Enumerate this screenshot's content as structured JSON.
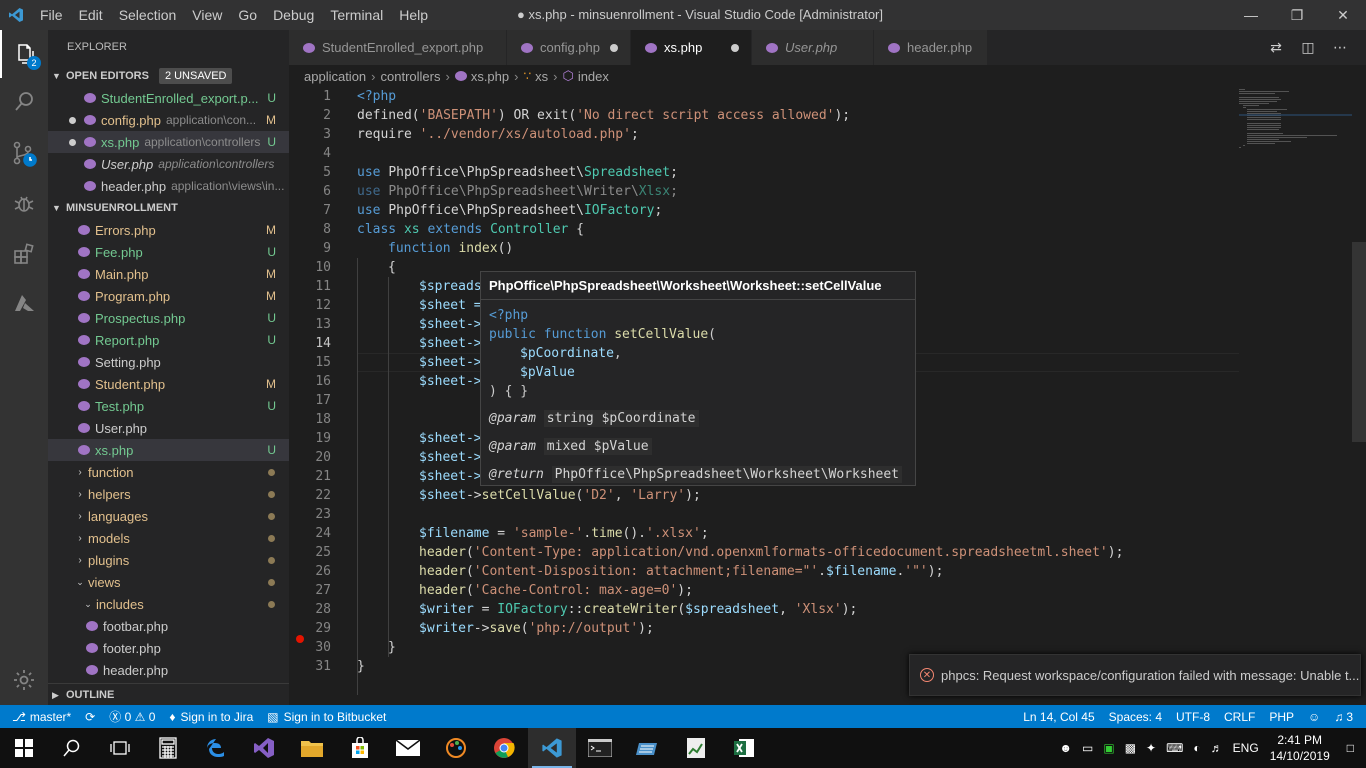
{
  "window": {
    "title": "● xs.php - minsuenrollment - Visual Studio Code [Administrator]",
    "menu": [
      "File",
      "Edit",
      "Selection",
      "View",
      "Go",
      "Debug",
      "Terminal",
      "Help"
    ]
  },
  "activity_bar": {
    "explorer_badge": "2"
  },
  "sidebar": {
    "header": "EXPLORER",
    "open_editors": {
      "title": "OPEN EDITORS",
      "unsaved": "2 UNSAVED",
      "items": [
        {
          "name": "StudentEnrolled_export.p...",
          "desc": "",
          "status": "U"
        },
        {
          "name": "config.php",
          "desc": "application\\con...",
          "status": "M"
        },
        {
          "name": "xs.php",
          "desc": "application\\controllers",
          "status": "U"
        },
        {
          "name": "User.php",
          "desc": "application\\controllers",
          "status": ""
        },
        {
          "name": "header.php",
          "desc": "application\\views\\in...",
          "status": ""
        }
      ]
    },
    "project": {
      "title": "MINSUENROLLMENT",
      "files": [
        {
          "name": "Errors.php",
          "status": "M"
        },
        {
          "name": "Fee.php",
          "status": "U"
        },
        {
          "name": "Main.php",
          "status": "M"
        },
        {
          "name": "Program.php",
          "status": "M"
        },
        {
          "name": "Prospectus.php",
          "status": "U"
        },
        {
          "name": "Report.php",
          "status": "U"
        },
        {
          "name": "Setting.php",
          "status": ""
        },
        {
          "name": "Student.php",
          "status": "M"
        },
        {
          "name": "Test.php",
          "status": "U"
        },
        {
          "name": "User.php",
          "status": ""
        },
        {
          "name": "xs.php",
          "status": "U"
        }
      ],
      "folders": [
        "function",
        "helpers",
        "languages",
        "models",
        "plugins",
        "views"
      ],
      "subfolder": "includes",
      "subfiles": [
        "footbar.php",
        "footer.php",
        "header.php"
      ]
    },
    "outline": "OUTLINE"
  },
  "tabs": [
    {
      "label": "StudentEnrolled_export.php"
    },
    {
      "label": "config.php"
    },
    {
      "label": "xs.php"
    },
    {
      "label": "User.php"
    },
    {
      "label": "header.php"
    }
  ],
  "breadcrumb": [
    "application",
    "controllers",
    "xs.php",
    "xs",
    "index"
  ],
  "code": {
    "line_numbers": [
      "1",
      "2",
      "3",
      "4",
      "5",
      "6",
      "7",
      "8",
      "9",
      "10",
      "11",
      "12",
      "13",
      "14",
      "15",
      "16",
      "17",
      "18",
      "19",
      "20",
      "21",
      "22",
      "23",
      "24",
      "25",
      "26",
      "27",
      "28",
      "29",
      "30",
      "31"
    ],
    "l1": "<?php",
    "l2a": "defined(",
    "l2b": "'BASEPATH'",
    "l2c": ") OR exit(",
    "l2d": "'No direct script access allowed'",
    "l2e": ");",
    "l3a": "require ",
    "l3b": "'../vendor/xs/autoload.php'",
    "l3c": ";",
    "l5a": "use ",
    "l5b": "PhpOffice\\PhpSpreadsheet\\",
    "l5c": "Spreadsheet",
    "l6a": "use ",
    "l6b": "PhpOffice\\PhpSpreadsheet\\Writer\\",
    "l6c": "Xlsx",
    "l7a": "use ",
    "l7b": "PhpOffice\\PhpSpreadsheet\\",
    "l7c": "IOFactory",
    "l8a": "class ",
    "l8b": "xs ",
    "l8c": "extends ",
    "l8d": "Controller",
    "l8e": " {",
    "l9a": "function ",
    "l9b": "index",
    "l9c": "()",
    "l10": "{",
    "l11": "$spreads",
    "l12": "$sheet =",
    "l13": "$sheet->",
    "l14": "$sheet->",
    "l15": "$sheet->",
    "l16": "$sheet->",
    "l19": "$sheet->",
    "l20": "$sheet->",
    "l21": "$sheet->",
    "l22a": "$sheet",
    "l22b": "->",
    "l22c": "setCellValue",
    "l22d": "(",
    "l22e": "'D2'",
    "l22f": ", ",
    "l22g": "'Larry'",
    "l22h": ");",
    "l24a": "$filename",
    "l24b": " = ",
    "l24c": "'sample-'",
    "l24d": ".",
    "l24e": "time",
    "l24f": "().",
    "l24g": "'.xlsx'",
    "l24h": ";",
    "l25a": "header",
    "l25b": "(",
    "l25c": "'Content-Type: application/vnd.openxmlformats-officedocument.spreadsheetml.sheet'",
    "l25d": ");",
    "l26a": "header",
    "l26b": "(",
    "l26c": "'Content-Disposition: attachment;filename=\"'",
    "l26d": ".",
    "l26e": "$filename",
    "l26f": ".",
    "l26g": "'\"'",
    "l26h": ");",
    "l27a": "header",
    "l27b": "(",
    "l27c": "'Cache-Control: max-age=0'",
    "l27d": ");",
    "l28a": "$writer",
    "l28b": " = ",
    "l28c": "IOFactory",
    "l28d": "::",
    "l28e": "createWriter",
    "l28f": "(",
    "l28g": "$spreadsheet",
    "l28h": ", ",
    "l28i": "'Xlsx'",
    "l28j": ");",
    "l29a": "$writer",
    "l29b": "->",
    "l29c": "save",
    "l29d": "(",
    "l29e": "'php://output'",
    "l29f": ");",
    "l30": "}",
    "l31": "}"
  },
  "hover": {
    "title": "PhpOffice\\PhpSpreadsheet\\Worksheet\\Worksheet::setCellValue",
    "c1": "<?php",
    "c2a": "public function ",
    "c2b": "setCellValue",
    "c2c": "(",
    "c3": "$pCoordinate",
    "c3b": ",",
    "c4": "$pValue",
    "c5": ") { }",
    "tag1": "@param",
    "val1": "string $pCoordinate",
    "tag2": "@param",
    "val2": "mixed $pValue",
    "tag3": "@return",
    "val3": "PhpOffice\\PhpSpreadsheet\\Worksheet\\Worksheet"
  },
  "notification": "phpcs: Request workspace/configuration failed with message: Unable t...",
  "statusbar": {
    "branch": "master*",
    "errors": "0",
    "warnings": "0",
    "jira": "Sign in to Jira",
    "bitbucket": "Sign in to Bitbucket",
    "position": "Ln 14, Col 45",
    "spaces": "Spaces: 4",
    "encoding": "UTF-8",
    "eol": "CRLF",
    "language": "PHP",
    "bell_count": "3"
  },
  "taskbar": {
    "lang": "ENG",
    "time": "2:41 PM",
    "date": "14/10/2019"
  }
}
